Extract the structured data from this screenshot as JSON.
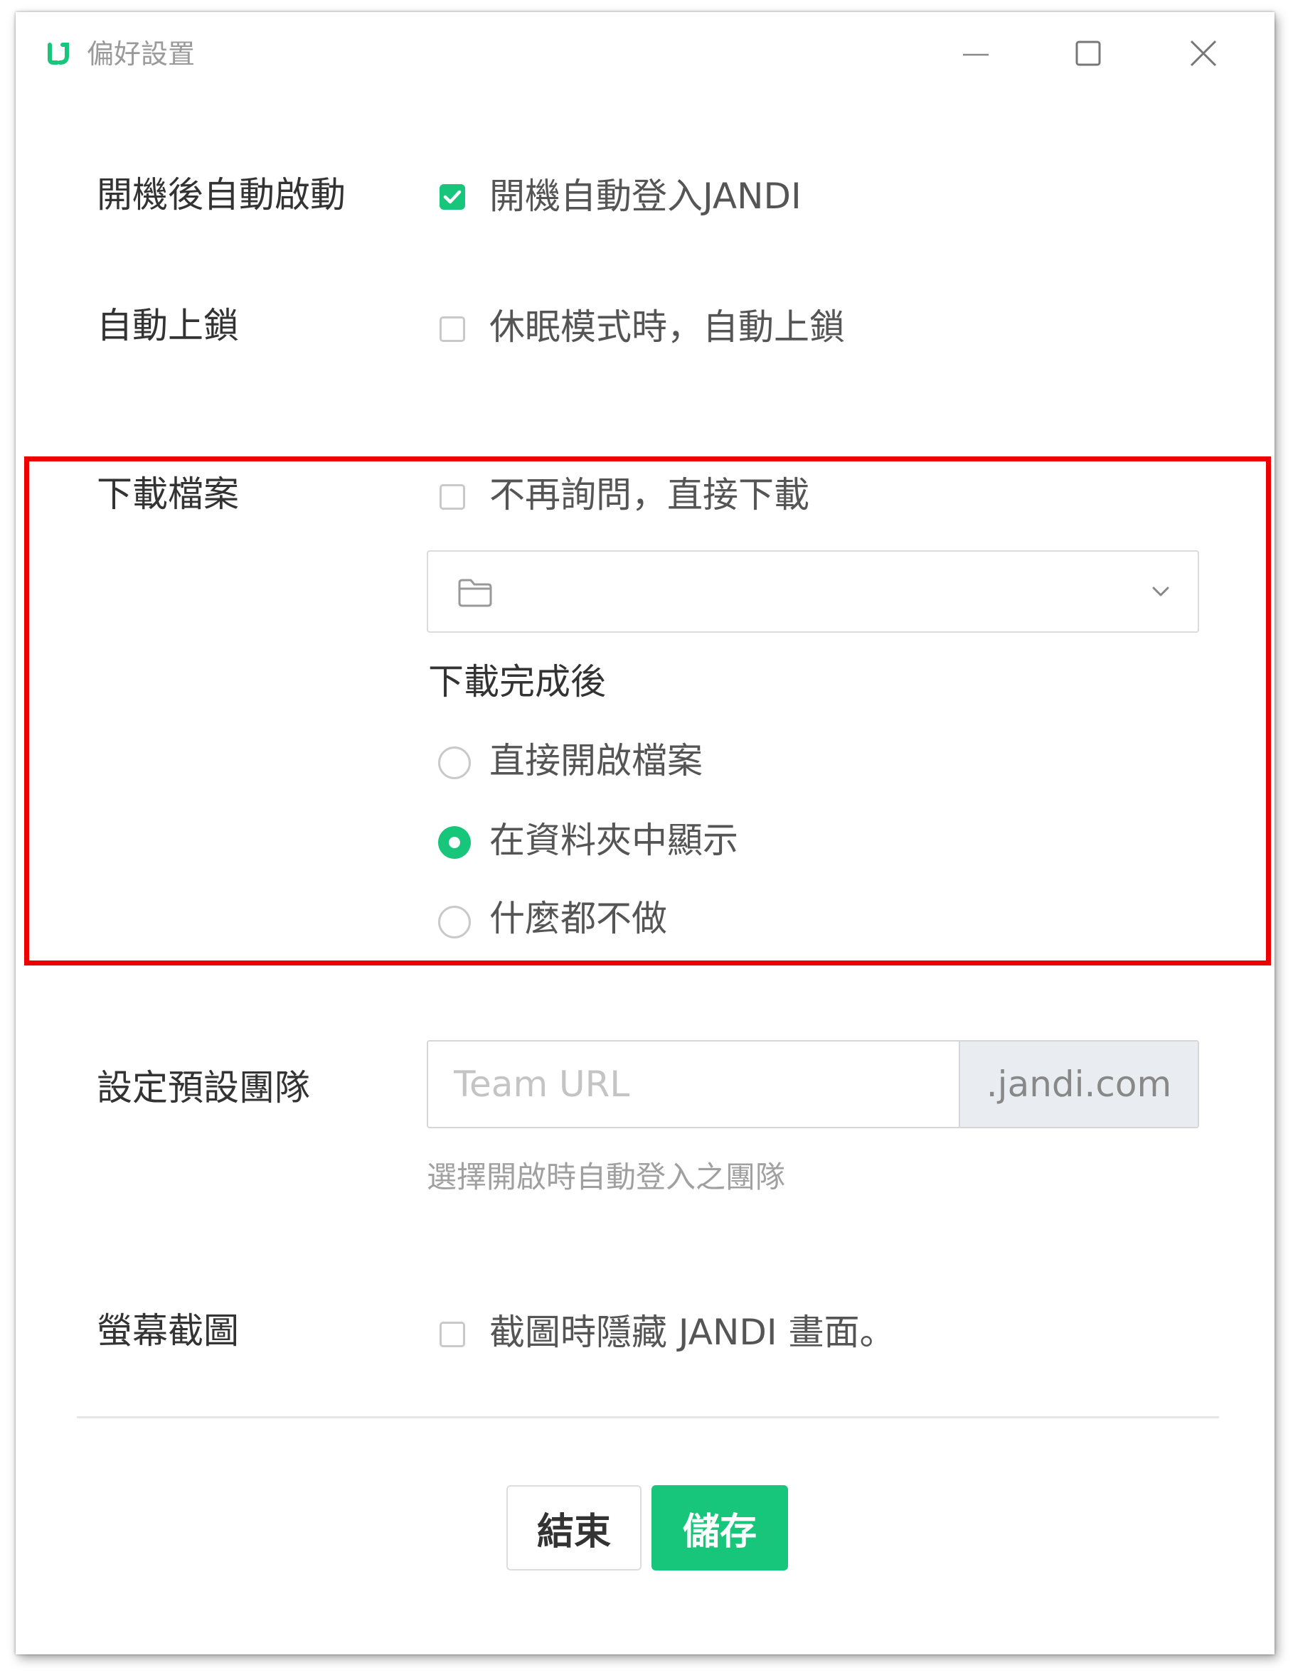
{
  "window": {
    "title": "偏好設置",
    "accent_color": "#17c67a",
    "highlight_color": "#ee0000"
  },
  "startup": {
    "label": "開機後自動啟動",
    "option_label": "開機自動登入JANDI",
    "checked": true
  },
  "auto_lock": {
    "label": "自動上鎖",
    "option_label": "休眠模式時，自動上鎖",
    "checked": false
  },
  "download": {
    "label": "下載檔案",
    "ask_option_label": "不再詢問，直接下載",
    "ask_checked": false,
    "folder_icon": "folder-icon",
    "after_label": "下載完成後",
    "after_options": [
      {
        "label": "直接開啟檔案",
        "selected": false
      },
      {
        "label": "在資料夾中顯示",
        "selected": true
      },
      {
        "label": "什麼都不做",
        "selected": false
      }
    ]
  },
  "default_team": {
    "label": "設定預設團隊",
    "placeholder": "Team URL",
    "value": "",
    "suffix": ".jandi.com",
    "helper": "選擇開啟時自動登入之團隊"
  },
  "screenshot": {
    "label": "螢幕截圖",
    "option_label": "截圖時隱藏 JANDI 畫面。",
    "checked": false
  },
  "footer": {
    "exit_label": "結束",
    "save_label": "儲存"
  }
}
